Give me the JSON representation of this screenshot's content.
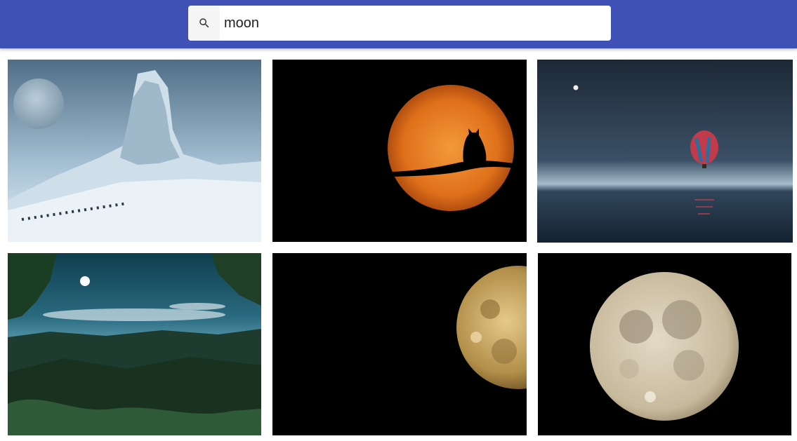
{
  "search": {
    "value": "moon",
    "icon": "search-icon"
  },
  "theme": {
    "appbar": "#3f51b5",
    "search_button_bg": "#f5f5f5"
  },
  "results": [
    {
      "name": "statue-moon-snow",
      "icon": "image"
    },
    {
      "name": "cat-on-branch-orange-moon",
      "icon": "image"
    },
    {
      "name": "hot-air-balloon-night-sea",
      "icon": "image"
    },
    {
      "name": "forest-moonlit-landscape",
      "icon": "image"
    },
    {
      "name": "half-moon-crater-black",
      "icon": "image"
    },
    {
      "name": "full-moon-black",
      "icon": "image"
    }
  ]
}
